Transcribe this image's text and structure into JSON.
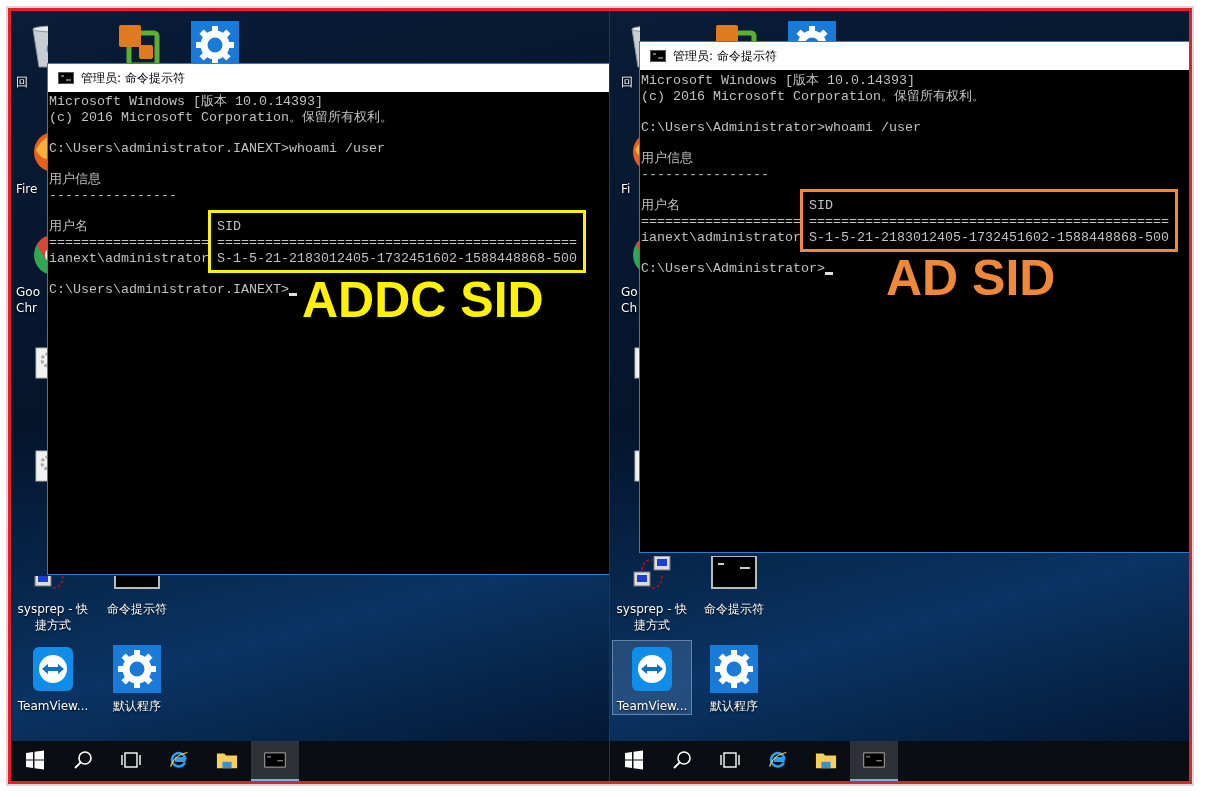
{
  "desktops": [
    {
      "icons": [
        {
          "kind": "recycle-bin",
          "label_lines": [
            "回"
          ],
          "selected": false
        },
        {
          "kind": "vm-app",
          "selected": false
        },
        {
          "kind": "settings",
          "selected": false
        },
        {
          "kind": "firefox",
          "label_lines": [
            "Fire"
          ],
          "selected": false
        },
        {
          "kind": "chrome",
          "label_lines": [
            "Goo",
            "Chr"
          ],
          "selected": false
        },
        {
          "kind": "gear-file",
          "selected": false
        },
        {
          "kind": "gear-file",
          "selected": false
        },
        {
          "kind": "sysprep",
          "label_lines": [
            "sysprep - 快",
            "捷方式"
          ],
          "selected": false
        },
        {
          "kind": "cmd",
          "label_lines": [
            "命令提示符"
          ],
          "selected": false
        },
        {
          "kind": "teamviewer",
          "label_lines": [
            "TeamView..."
          ],
          "selected": false
        },
        {
          "kind": "settings",
          "label_lines": [
            "默认程序"
          ],
          "selected": false
        }
      ],
      "console": {
        "title": "管理员: 命令提示符",
        "blocks": [
          [
            "Microsoft Windows [版本 10.0.14393]",
            "(c) 2016 Microsoft Corporation。保留所有权利。"
          ],
          [
            "C:\\Users\\administrator.IANEXT>whoami /user"
          ],
          [
            "用户信息",
            "----------------"
          ]
        ],
        "columns": [
          {
            "header": "用户名",
            "rule": "====================",
            "value": "ianext\\administrator"
          },
          {
            "header": "SID",
            "rule": "=============================================",
            "value": "S-1-5-21-2183012405-1732451602-1588448868-500"
          }
        ],
        "prompt": "C:\\Users\\administrator.IANEXT>",
        "highlight": {
          "color": "#fff200",
          "label": "ADDC SID"
        }
      },
      "taskbar": [
        {
          "kind": "start",
          "active": false
        },
        {
          "kind": "search",
          "active": false
        },
        {
          "kind": "task-view",
          "active": false
        },
        {
          "kind": "ie",
          "active": false
        },
        {
          "kind": "folder",
          "active": false
        },
        {
          "kind": "cmd",
          "active": true
        }
      ]
    },
    {
      "icons": [
        {
          "kind": "recycle-bin",
          "label_lines": [
            "回"
          ],
          "selected": false
        },
        {
          "kind": "vm-app",
          "selected": false
        },
        {
          "kind": "settings",
          "selected": false
        },
        {
          "kind": "firefox",
          "label_lines": [
            "Fi"
          ],
          "selected": false
        },
        {
          "kind": "chrome",
          "label_lines": [
            "Go",
            "Ch"
          ],
          "selected": false
        },
        {
          "kind": "gear-file",
          "selected": false
        },
        {
          "kind": "gear-file",
          "selected": false
        },
        {
          "kind": "sysprep",
          "label_lines": [
            "sysprep - 快",
            "捷方式"
          ],
          "selected": false
        },
        {
          "kind": "cmd",
          "label_lines": [
            "命令提示符"
          ],
          "selected": false
        },
        {
          "kind": "teamviewer",
          "label_lines": [
            "TeamView..."
          ],
          "selected": true
        },
        {
          "kind": "settings",
          "label_lines": [
            "默认程序"
          ],
          "selected": false
        }
      ],
      "console": {
        "title": "管理员: 命令提示符",
        "blocks": [
          [
            "Microsoft Windows [版本 10.0.14393]",
            "(c) 2016 Microsoft Corporation。保留所有权利。"
          ],
          [
            "C:\\Users\\Administrator>whoami /user"
          ],
          [
            "用户信息",
            "----------------"
          ]
        ],
        "columns": [
          {
            "header": "用户名",
            "rule": "====================",
            "value": "ianext\\administrator"
          },
          {
            "header": "SID",
            "rule": "=============================================",
            "value": "S-1-5-21-2183012405-1732451602-1588448868-500"
          }
        ],
        "prompt": "C:\\Users\\Administrator>",
        "highlight": {
          "color": "#f0883a",
          "label": "AD SID"
        }
      },
      "taskbar": [
        {
          "kind": "start",
          "active": false
        },
        {
          "kind": "search",
          "active": false
        },
        {
          "kind": "task-view",
          "active": false
        },
        {
          "kind": "ie",
          "active": false
        },
        {
          "kind": "folder",
          "active": false
        },
        {
          "kind": "cmd",
          "active": true
        }
      ]
    }
  ]
}
